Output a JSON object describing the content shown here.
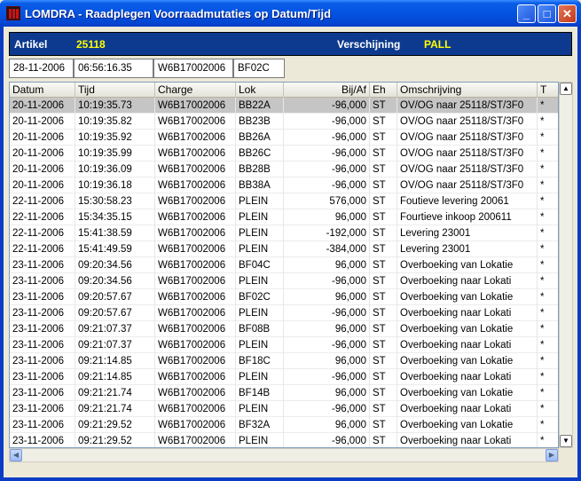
{
  "window": {
    "title": "LOMDRA - Raadplegen Voorraadmutaties op Datum/Tijd",
    "minimize": "_",
    "maximize": "□",
    "close": "✕"
  },
  "header": {
    "artikel_label": "Artikel",
    "artikel_value": "25118",
    "verschijning_label": "Verschijning",
    "verschijning_value": "PALL"
  },
  "info": {
    "date": "28-11-2006",
    "time": "06:56:16.35",
    "charge": "W6B17002006",
    "lok": "BF02C"
  },
  "table": {
    "columns": [
      "Datum",
      "Tijd",
      "Charge",
      "Lok",
      "Bij/Af",
      "Eh",
      "Omschrijving",
      "T"
    ],
    "rows": [
      [
        "20-11-2006",
        "10:19:35.73",
        "W6B17002006",
        "BB22A",
        "-96,000",
        "ST",
        "OV/OG naar 25118/ST/3F0",
        "*"
      ],
      [
        "20-11-2006",
        "10:19:35.82",
        "W6B17002006",
        "BB23B",
        "-96,000",
        "ST",
        "OV/OG naar 25118/ST/3F0",
        "*"
      ],
      [
        "20-11-2006",
        "10:19:35.92",
        "W6B17002006",
        "BB26A",
        "-96,000",
        "ST",
        "OV/OG naar 25118/ST/3F0",
        "*"
      ],
      [
        "20-11-2006",
        "10:19:35.99",
        "W6B17002006",
        "BB26C",
        "-96,000",
        "ST",
        "OV/OG naar 25118/ST/3F0",
        "*"
      ],
      [
        "20-11-2006",
        "10:19:36.09",
        "W6B17002006",
        "BB28B",
        "-96,000",
        "ST",
        "OV/OG naar 25118/ST/3F0",
        "*"
      ],
      [
        "20-11-2006",
        "10:19:36.18",
        "W6B17002006",
        "BB38A",
        "-96,000",
        "ST",
        "OV/OG naar 25118/ST/3F0",
        "*"
      ],
      [
        "22-11-2006",
        "15:30:58.23",
        "W6B17002006",
        "PLEIN",
        "576,000",
        "ST",
        "Foutieve levering 20061",
        "*"
      ],
      [
        "22-11-2006",
        "15:34:35.15",
        "W6B17002006",
        "PLEIN",
        "96,000",
        "ST",
        "Fourtieve inkoop 200611",
        "*"
      ],
      [
        "22-11-2006",
        "15:41:38.59",
        "W6B17002006",
        "PLEIN",
        "-192,000",
        "ST",
        "Levering 23001",
        "*"
      ],
      [
        "22-11-2006",
        "15:41:49.59",
        "W6B17002006",
        "PLEIN",
        "-384,000",
        "ST",
        "Levering 23001",
        "*"
      ],
      [
        "23-11-2006",
        "09:20:34.56",
        "W6B17002006",
        "BF04C",
        "96,000",
        "ST",
        "Overboeking van Lokatie",
        "*"
      ],
      [
        "23-11-2006",
        "09:20:34.56",
        "W6B17002006",
        "PLEIN",
        "-96,000",
        "ST",
        "Overboeking naar Lokati",
        "*"
      ],
      [
        "23-11-2006",
        "09:20:57.67",
        "W6B17002006",
        "BF02C",
        "96,000",
        "ST",
        "Overboeking van Lokatie",
        "*"
      ],
      [
        "23-11-2006",
        "09:20:57.67",
        "W6B17002006",
        "PLEIN",
        "-96,000",
        "ST",
        "Overboeking naar Lokati",
        "*"
      ],
      [
        "23-11-2006",
        "09:21:07.37",
        "W6B17002006",
        "BF08B",
        "96,000",
        "ST",
        "Overboeking van Lokatie",
        "*"
      ],
      [
        "23-11-2006",
        "09:21:07.37",
        "W6B17002006",
        "PLEIN",
        "-96,000",
        "ST",
        "Overboeking naar Lokati",
        "*"
      ],
      [
        "23-11-2006",
        "09:21:14.85",
        "W6B17002006",
        "BF18C",
        "96,000",
        "ST",
        "Overboeking van Lokatie",
        "*"
      ],
      [
        "23-11-2006",
        "09:21:14.85",
        "W6B17002006",
        "PLEIN",
        "-96,000",
        "ST",
        "Overboeking naar Lokati",
        "*"
      ],
      [
        "23-11-2006",
        "09:21:21.74",
        "W6B17002006",
        "BF14B",
        "96,000",
        "ST",
        "Overboeking van Lokatie",
        "*"
      ],
      [
        "23-11-2006",
        "09:21:21.74",
        "W6B17002006",
        "PLEIN",
        "-96,000",
        "ST",
        "Overboeking naar Lokati",
        "*"
      ],
      [
        "23-11-2006",
        "09:21:29.52",
        "W6B17002006",
        "BF32A",
        "96,000",
        "ST",
        "Overboeking van Lokatie",
        "*"
      ],
      [
        "23-11-2006",
        "09:21:29.52",
        "W6B17002006",
        "PLEIN",
        "-96,000",
        "ST",
        "Overboeking naar Lokati",
        "*"
      ]
    ]
  },
  "scrollbars": {
    "up": "▲",
    "down": "▼",
    "left": "◀",
    "right": "▶"
  }
}
